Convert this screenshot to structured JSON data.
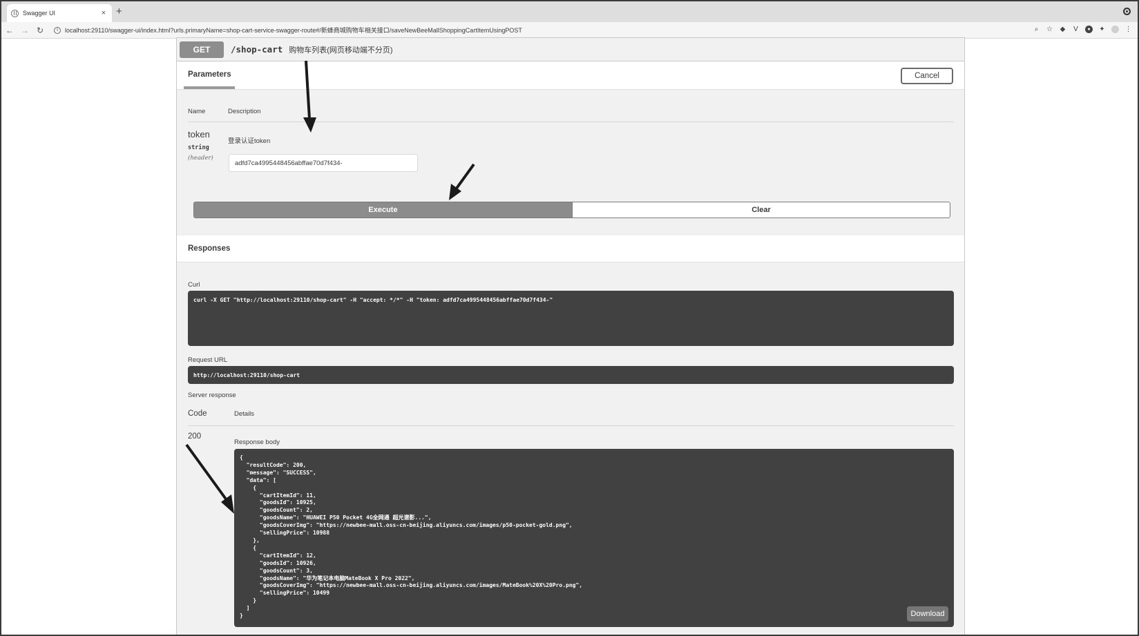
{
  "browser": {
    "tab_title": "Swagger UI",
    "tab_close": "×",
    "new_tab": "+",
    "url": "localhost:29110/swagger-ui/index.html?urls.primaryName=shop-cart-service-swagger-route#/新蜂商城购物车相关接口/saveNewBeeMallShoppingCartItemUsingPOST",
    "back": "←",
    "forward": "→",
    "reload": "↻",
    "info": "i",
    "extensions": {
      "zoom": "⌕",
      "star": "☆",
      "ext1": "◆",
      "ext2": "V",
      "ext3": "●",
      "ext4": "✦",
      "ext5": "◯",
      "menu": "⋮"
    }
  },
  "operation": {
    "method": "GET",
    "path": "/shop-cart",
    "summary": "购物车列表(网页移动端不分页)"
  },
  "parameters": {
    "title": "Parameters",
    "cancel_label": "Cancel",
    "col_name": "Name",
    "col_description": "Description",
    "param": {
      "name": "token",
      "type": "string",
      "in": "(header)",
      "description": "登录认证token",
      "value": "adfd7ca4995448456abffae70d7f434-"
    },
    "execute_label": "Execute",
    "clear_label": "Clear"
  },
  "responses": {
    "title": "Responses",
    "curl_label": "Curl",
    "curl_command": "curl -X GET \"http://localhost:29110/shop-cart\" -H \"accept: */*\" -H \"token: adfd7ca4995448456abffae70d7f434-\"",
    "request_url_label": "Request URL",
    "request_url": "http://localhost:29110/shop-cart",
    "server_response_label": "Server response",
    "code_header": "Code",
    "details_header": "Details",
    "status_code": "200",
    "response_body_label": "Response body",
    "response_body": "{\n  \"resultCode\": 200,\n  \"message\": \"SUCCESS\",\n  \"data\": [\n    {\n      \"cartItemId\": 11,\n      \"goodsId\": 10925,\n      \"goodsCount\": 2,\n      \"goodsName\": \"HUAWEI P50 Pocket 4G全网通 超光谱影...\",\n      \"goodsCoverImg\": \"https://newbee-mall.oss-cn-beijing.aliyuncs.com/images/p50-pocket-gold.png\",\n      \"sellingPrice\": 10988\n    },\n    {\n      \"cartItemId\": 12,\n      \"goodsId\": 10926,\n      \"goodsCount\": 3,\n      \"goodsName\": \"华为笔记本电脑MateBook X Pro 2022\",\n      \"goodsCoverImg\": \"https://newbee-mall.oss-cn-beijing.aliyuncs.com/images/MateBook%20X%20Pro.png\",\n      \"sellingPrice\": 10499\n    }\n  ]\n}",
    "download_label": "Download"
  }
}
